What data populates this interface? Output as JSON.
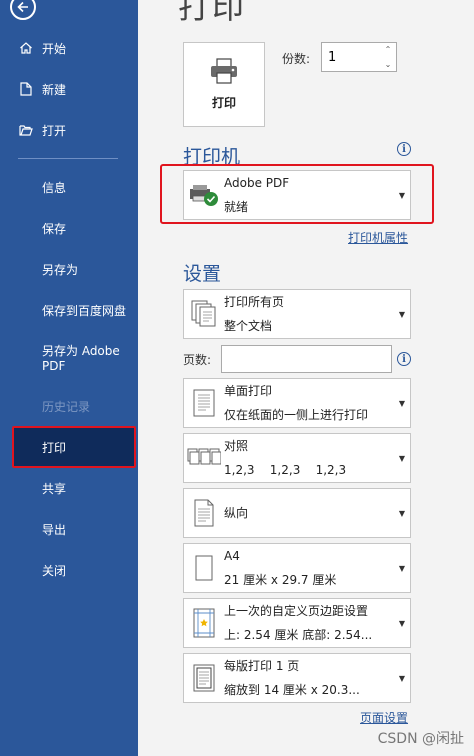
{
  "sidebar": {
    "items": [
      {
        "label": "开始"
      },
      {
        "label": "新建"
      },
      {
        "label": "打开"
      },
      {
        "label": "信息"
      },
      {
        "label": "保存"
      },
      {
        "label": "另存为"
      },
      {
        "label": "保存到百度网盘"
      },
      {
        "label": "另存为 Adobe PDF"
      },
      {
        "label": "历史记录"
      },
      {
        "label": "打印"
      },
      {
        "label": "共享"
      },
      {
        "label": "导出"
      },
      {
        "label": "关闭"
      }
    ]
  },
  "main": {
    "title": "打印",
    "print_button": "打印",
    "copies_label": "份数:",
    "copies_value": "1",
    "printer_section": "打印机",
    "printer": {
      "name": "Adobe PDF",
      "status": "就绪"
    },
    "printer_properties": "打印机属性",
    "settings_section": "设置",
    "settings": [
      {
        "line1": "打印所有页",
        "line2": "整个文档"
      },
      {
        "line1": "单面打印",
        "line2": "仅在纸面的一侧上进行打印"
      },
      {
        "line1": "对照",
        "line2": "1,2,3    1,2,3    1,2,3"
      },
      {
        "line1": "纵向",
        "line2": ""
      },
      {
        "line1": "A4",
        "line2": "21 厘米 x 29.7 厘米"
      },
      {
        "line1": "上一次的自定义页边距设置",
        "line2": "上: 2.54 厘米 底部: 2.54..."
      },
      {
        "line1": "每版打印 1 页",
        "line2": "缩放到 14 厘米 x 20.3..."
      }
    ],
    "pages_label": "页数:",
    "pages_value": "",
    "page_setup": "页面设置"
  },
  "watermark": "CSDN @闲扯"
}
